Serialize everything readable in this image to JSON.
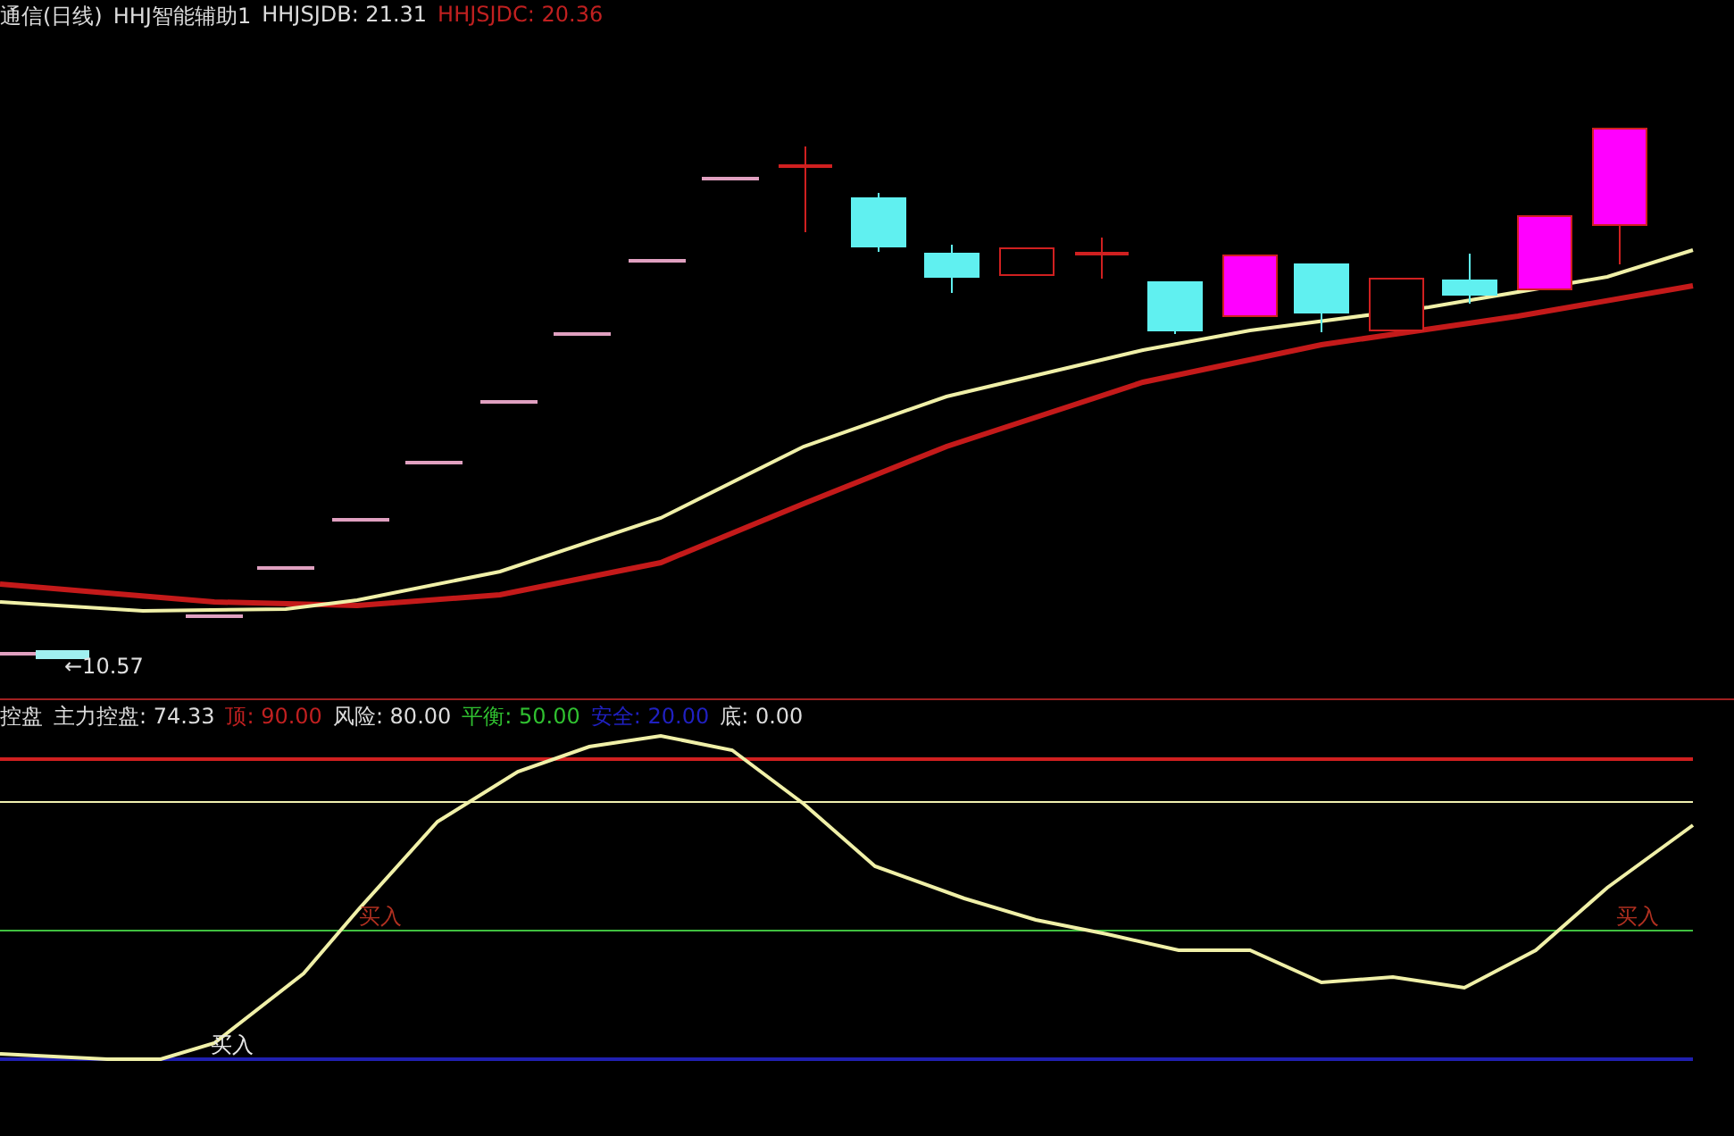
{
  "main_panel": {
    "legend": [
      {
        "text": "通信(日线)",
        "color": "#dcdcdc"
      },
      {
        "text": "HHJ智能辅助1",
        "color": "#dcdcdc"
      },
      {
        "text": "HHJSJDB: 21.31",
        "color": "#dcdcdc"
      },
      {
        "text": "HHJSJDC: 20.36",
        "color": "#c02020"
      }
    ],
    "price_label": "←10.57"
  },
  "indicator_panel": {
    "legend": [
      {
        "text": "控盘",
        "color": "#dcdcdc"
      },
      {
        "text": "主力控盘: 74.33",
        "color": "#dcdcdc"
      },
      {
        "text": "顶: 90.00",
        "color": "#c02020"
      },
      {
        "text": "风险: 80.00",
        "color": "#dcdcdc"
      },
      {
        "text": "平衡: 50.00",
        "color": "#30c030"
      },
      {
        "text": "安全: 20.00",
        "color": "#2020c0"
      },
      {
        "text": "底: 0.00",
        "color": "#dcdcdc"
      }
    ],
    "annotations": [
      {
        "text": "买入",
        "color": "#b03020"
      },
      {
        "text": "买入",
        "color": "#b03020"
      },
      {
        "text": "买入",
        "color": "#e8e8e8"
      }
    ]
  }
}
